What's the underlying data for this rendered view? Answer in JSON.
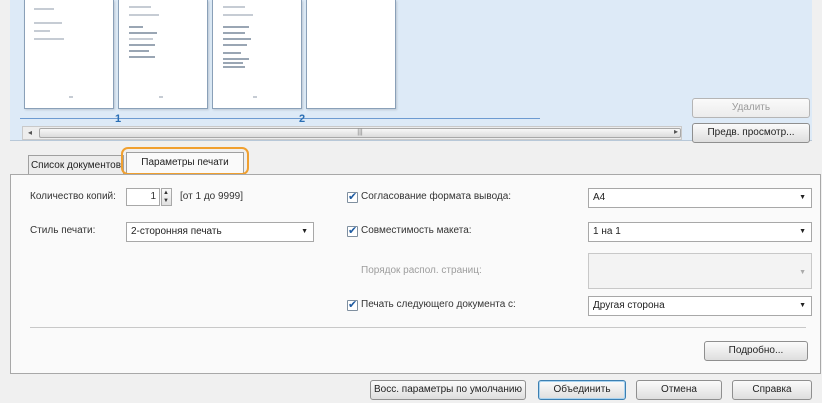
{
  "preview": {
    "page_numbers": [
      "1",
      "2"
    ],
    "delete_button": "Удалить",
    "preview_button": "Предв. просмотр...",
    "scrollbar": {
      "left_arrow": "◂",
      "right_arrow": "▸",
      "grip": "|||"
    }
  },
  "tabs": [
    {
      "label": "Список документов"
    },
    {
      "label": "Параметры печати"
    }
  ],
  "settings": {
    "copies_label": "Количество копий:",
    "copies_value": "1",
    "copies_range": "[от 1 до 9999]",
    "print_style_label": "Стиль печати:",
    "print_style_value": "2-сторонняя печать",
    "match_output_size_label": "Согласование формата вывода:",
    "match_output_size_value": "A4",
    "layout_compat_label": "Совместимость макета:",
    "layout_compat_value": "1 на 1",
    "page_order_label": "Порядок распол. страниц:",
    "page_order_value": "",
    "next_doc_label": "Печать следующего документа с:",
    "next_doc_value": "Другая сторона",
    "details_button": "Подробно..."
  },
  "footer": {
    "restore_defaults": "Восс. параметры по умолчанию",
    "combine": "Объединить",
    "cancel": "Отмена",
    "help": "Справка"
  },
  "colors": {
    "preview_bg": "#ddeaf7",
    "tab_highlight": "#f0a030",
    "page_number": "#2a6fb5"
  }
}
